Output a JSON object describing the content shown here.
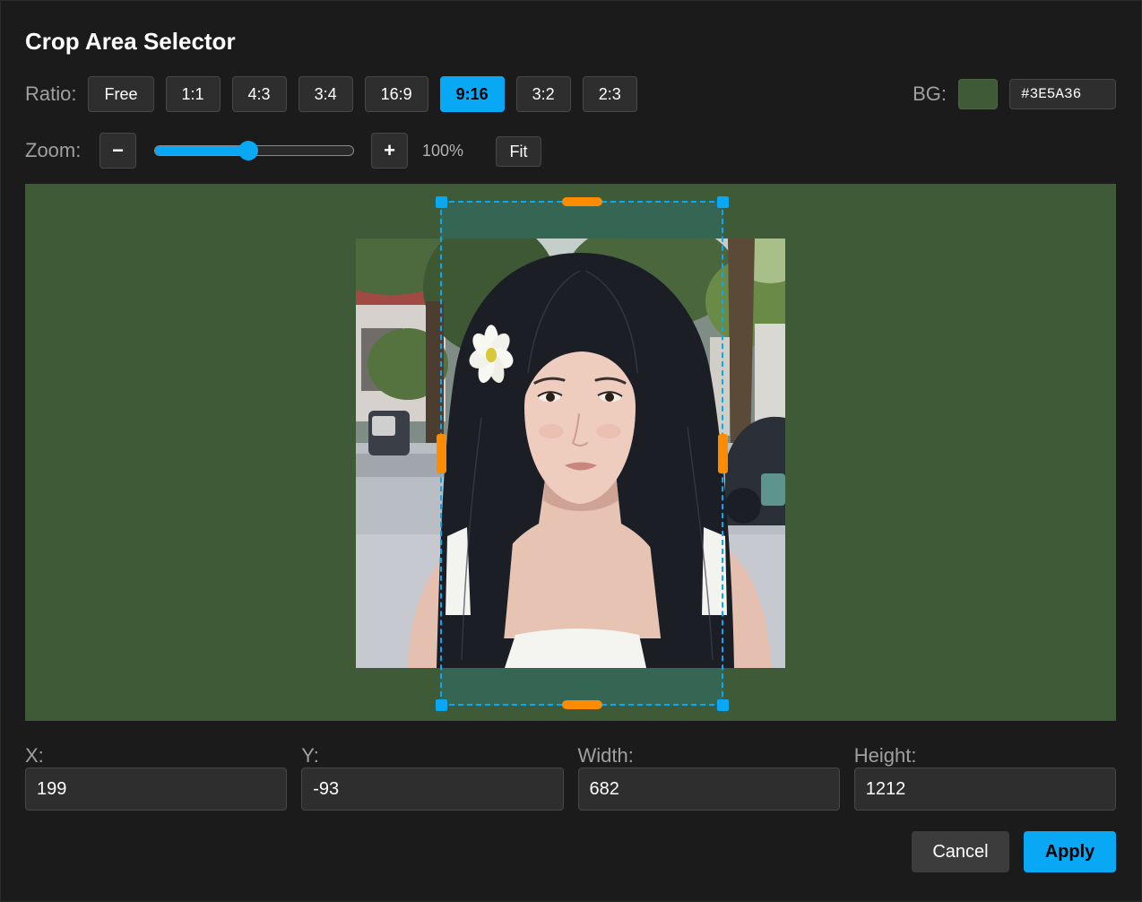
{
  "dialog": {
    "title": "Crop Area Selector"
  },
  "ratio": {
    "label": "Ratio:",
    "options": [
      {
        "label": "Free",
        "active": false
      },
      {
        "label": "1:1",
        "active": false
      },
      {
        "label": "4:3",
        "active": false
      },
      {
        "label": "3:4",
        "active": false
      },
      {
        "label": "16:9",
        "active": false
      },
      {
        "label": "9:16",
        "active": true
      },
      {
        "label": "3:2",
        "active": false
      },
      {
        "label": "2:3",
        "active": false
      }
    ]
  },
  "background": {
    "label": "BG:",
    "color": "#3E5A36",
    "value": "#3E5A36"
  },
  "zoom": {
    "label": "Zoom:",
    "minus_label": "−",
    "plus_label": "+",
    "value_text": "100%",
    "slider_fraction": 0.47,
    "fit_label": "Fit"
  },
  "fields": [
    {
      "label": "X:",
      "value": "199"
    },
    {
      "label": "Y:",
      "value": "-93"
    },
    {
      "label": "Width:",
      "value": "682"
    },
    {
      "label": "Height:",
      "value": "1212"
    }
  ],
  "actions": {
    "cancel_label": "Cancel",
    "apply_label": "Apply"
  },
  "colors": {
    "accent": "#08A8F5",
    "handle": "#FF8C00"
  }
}
